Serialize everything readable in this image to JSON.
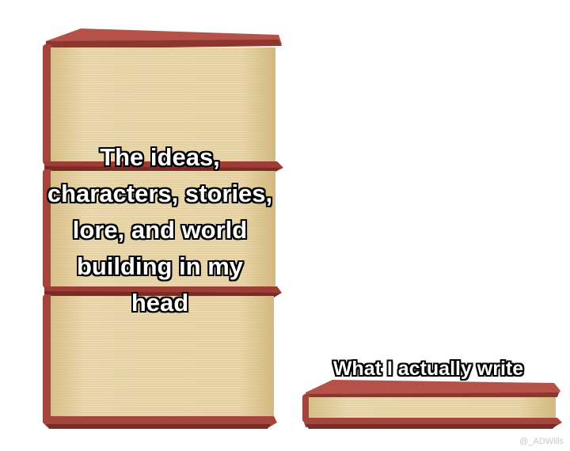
{
  "captions": {
    "big_stack": "The ideas, characters, stories, lore, and world building in my head",
    "thin_book": "What I actually write"
  },
  "watermark": "@_ADWills",
  "colors": {
    "cover": "#a9483f",
    "cover_shadow": "#7c2e28",
    "pages": "#e7d3a6",
    "pages_shade": "#d6bd86",
    "background": "#ffffff"
  }
}
